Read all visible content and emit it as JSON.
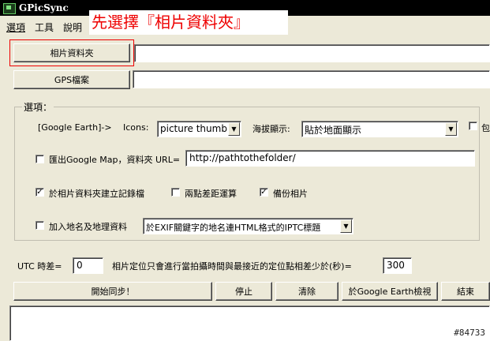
{
  "window": {
    "title": "GPicSync"
  },
  "menu": [
    {
      "label": "選項",
      "key": ""
    },
    {
      "label": "工具",
      "key": ""
    },
    {
      "label": "說明",
      "key": ""
    }
  ],
  "annotation": "先選擇『相片資料夾』",
  "photo_folder": {
    "button": "相片資料夾",
    "value": ""
  },
  "gps_file": {
    "button": "GPS檔案",
    "value": ""
  },
  "options": {
    "group_label": "選項：",
    "google_earth_label": "[Google Earth]->",
    "icons_label": "Icons:",
    "icons_value": "picture thumb",
    "elevation_label": "海拔顯示:",
    "elevation_value": "貼於地面顯示",
    "include_label": "包",
    "google_map_label": "匯出Google Map，資料夾 URL=",
    "google_map_checked": false,
    "url_value": "http://pathtothefolder/",
    "create_log_label": "於相片資料夾建立記錄檔",
    "create_log_checked": true,
    "distance_label": "兩點差距運算",
    "distance_checked": false,
    "backup_label": "備份相片",
    "backup_checked": true,
    "geo_names_label": "加入地名及地理資料",
    "geo_names_checked": false,
    "geo_names_mode": "於EXIF關鍵字的地名連HTML格式的IPTC標題",
    "elevation_checkbox_checked": false
  },
  "utc": {
    "label": "UTC 時差=",
    "value": "0",
    "threshold_label": "相片定位只會進行當拍攝時間與最接近的定位點相差少於(秒)=",
    "threshold_value": "300"
  },
  "actions": {
    "start": "開始同步！",
    "stop": "停止",
    "clear": "清除",
    "view_google_earth": "於Google Earth檢視",
    "quit": "結束"
  },
  "watermark": "#84733",
  "colors": {
    "annotation": "#ee0000",
    "highlight_box": "#ee0000"
  }
}
